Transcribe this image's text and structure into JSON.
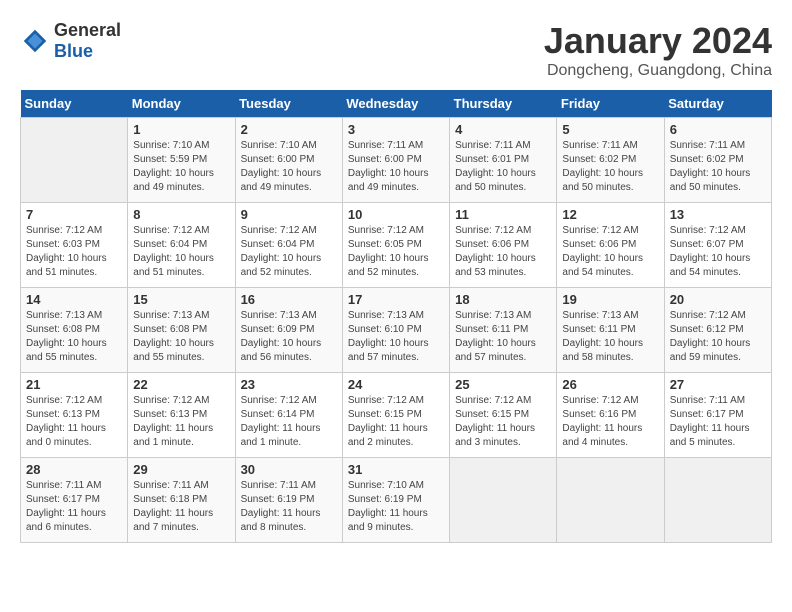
{
  "logo": {
    "general": "General",
    "blue": "Blue"
  },
  "header": {
    "month": "January 2024",
    "location": "Dongcheng, Guangdong, China"
  },
  "weekdays": [
    "Sunday",
    "Monday",
    "Tuesday",
    "Wednesday",
    "Thursday",
    "Friday",
    "Saturday"
  ],
  "weeks": [
    [
      {
        "day": "",
        "info": ""
      },
      {
        "day": "1",
        "info": "Sunrise: 7:10 AM\nSunset: 5:59 PM\nDaylight: 10 hours\nand 49 minutes."
      },
      {
        "day": "2",
        "info": "Sunrise: 7:10 AM\nSunset: 6:00 PM\nDaylight: 10 hours\nand 49 minutes."
      },
      {
        "day": "3",
        "info": "Sunrise: 7:11 AM\nSunset: 6:00 PM\nDaylight: 10 hours\nand 49 minutes."
      },
      {
        "day": "4",
        "info": "Sunrise: 7:11 AM\nSunset: 6:01 PM\nDaylight: 10 hours\nand 50 minutes."
      },
      {
        "day": "5",
        "info": "Sunrise: 7:11 AM\nSunset: 6:02 PM\nDaylight: 10 hours\nand 50 minutes."
      },
      {
        "day": "6",
        "info": "Sunrise: 7:11 AM\nSunset: 6:02 PM\nDaylight: 10 hours\nand 50 minutes."
      }
    ],
    [
      {
        "day": "7",
        "info": "Sunrise: 7:12 AM\nSunset: 6:03 PM\nDaylight: 10 hours\nand 51 minutes."
      },
      {
        "day": "8",
        "info": "Sunrise: 7:12 AM\nSunset: 6:04 PM\nDaylight: 10 hours\nand 51 minutes."
      },
      {
        "day": "9",
        "info": "Sunrise: 7:12 AM\nSunset: 6:04 PM\nDaylight: 10 hours\nand 52 minutes."
      },
      {
        "day": "10",
        "info": "Sunrise: 7:12 AM\nSunset: 6:05 PM\nDaylight: 10 hours\nand 52 minutes."
      },
      {
        "day": "11",
        "info": "Sunrise: 7:12 AM\nSunset: 6:06 PM\nDaylight: 10 hours\nand 53 minutes."
      },
      {
        "day": "12",
        "info": "Sunrise: 7:12 AM\nSunset: 6:06 PM\nDaylight: 10 hours\nand 54 minutes."
      },
      {
        "day": "13",
        "info": "Sunrise: 7:12 AM\nSunset: 6:07 PM\nDaylight: 10 hours\nand 54 minutes."
      }
    ],
    [
      {
        "day": "14",
        "info": "Sunrise: 7:13 AM\nSunset: 6:08 PM\nDaylight: 10 hours\nand 55 minutes."
      },
      {
        "day": "15",
        "info": "Sunrise: 7:13 AM\nSunset: 6:08 PM\nDaylight: 10 hours\nand 55 minutes."
      },
      {
        "day": "16",
        "info": "Sunrise: 7:13 AM\nSunset: 6:09 PM\nDaylight: 10 hours\nand 56 minutes."
      },
      {
        "day": "17",
        "info": "Sunrise: 7:13 AM\nSunset: 6:10 PM\nDaylight: 10 hours\nand 57 minutes."
      },
      {
        "day": "18",
        "info": "Sunrise: 7:13 AM\nSunset: 6:11 PM\nDaylight: 10 hours\nand 57 minutes."
      },
      {
        "day": "19",
        "info": "Sunrise: 7:13 AM\nSunset: 6:11 PM\nDaylight: 10 hours\nand 58 minutes."
      },
      {
        "day": "20",
        "info": "Sunrise: 7:12 AM\nSunset: 6:12 PM\nDaylight: 10 hours\nand 59 minutes."
      }
    ],
    [
      {
        "day": "21",
        "info": "Sunrise: 7:12 AM\nSunset: 6:13 PM\nDaylight: 11 hours\nand 0 minutes."
      },
      {
        "day": "22",
        "info": "Sunrise: 7:12 AM\nSunset: 6:13 PM\nDaylight: 11 hours\nand 1 minute."
      },
      {
        "day": "23",
        "info": "Sunrise: 7:12 AM\nSunset: 6:14 PM\nDaylight: 11 hours\nand 1 minute."
      },
      {
        "day": "24",
        "info": "Sunrise: 7:12 AM\nSunset: 6:15 PM\nDaylight: 11 hours\nand 2 minutes."
      },
      {
        "day": "25",
        "info": "Sunrise: 7:12 AM\nSunset: 6:15 PM\nDaylight: 11 hours\nand 3 minutes."
      },
      {
        "day": "26",
        "info": "Sunrise: 7:12 AM\nSunset: 6:16 PM\nDaylight: 11 hours\nand 4 minutes."
      },
      {
        "day": "27",
        "info": "Sunrise: 7:11 AM\nSunset: 6:17 PM\nDaylight: 11 hours\nand 5 minutes."
      }
    ],
    [
      {
        "day": "28",
        "info": "Sunrise: 7:11 AM\nSunset: 6:17 PM\nDaylight: 11 hours\nand 6 minutes."
      },
      {
        "day": "29",
        "info": "Sunrise: 7:11 AM\nSunset: 6:18 PM\nDaylight: 11 hours\nand 7 minutes."
      },
      {
        "day": "30",
        "info": "Sunrise: 7:11 AM\nSunset: 6:19 PM\nDaylight: 11 hours\nand 8 minutes."
      },
      {
        "day": "31",
        "info": "Sunrise: 7:10 AM\nSunset: 6:19 PM\nDaylight: 11 hours\nand 9 minutes."
      },
      {
        "day": "",
        "info": ""
      },
      {
        "day": "",
        "info": ""
      },
      {
        "day": "",
        "info": ""
      }
    ]
  ]
}
